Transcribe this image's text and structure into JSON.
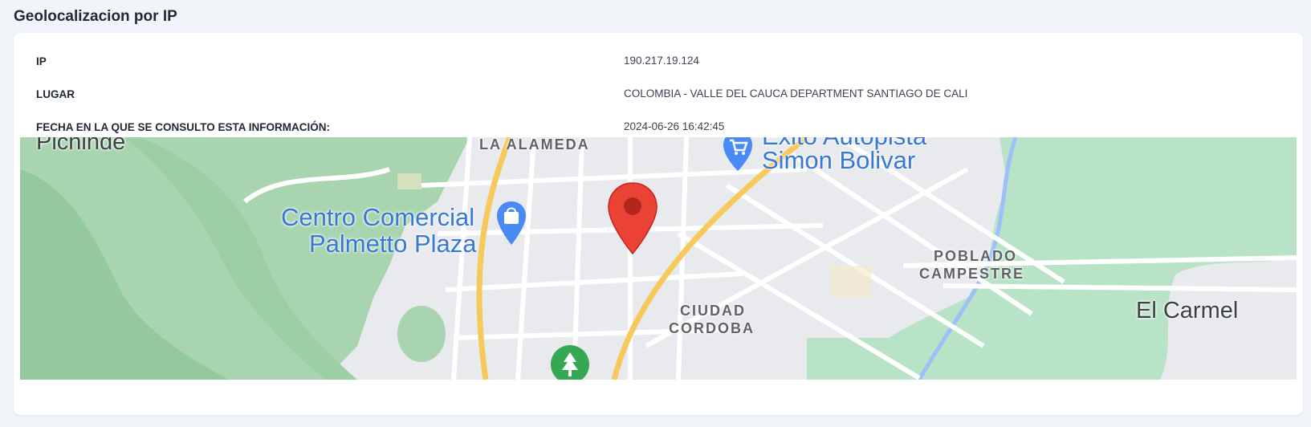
{
  "section": {
    "title": "Geolocalizacion por IP"
  },
  "info": {
    "ip_label": "IP",
    "ip_value": "190.217.19.124",
    "place_label": "LUGAR",
    "place_value": "COLOMBIA - VALLE DEL CAUCA DEPARTMENT SANTIAGO DE CALI",
    "date_label": "FECHA EN LA QUE SE CONSULTO ESTA INFORMACIÓN:",
    "date_value": "2024-06-26 16:42:45"
  },
  "map": {
    "labels": {
      "pichinde": "Pichinde",
      "alameda": "LA ALAMEDA",
      "exito_1": "Exito Autopista",
      "exito_2": "Simon Bolivar",
      "centro_1": "Centro Comercial",
      "centro_2": "Palmetto Plaza",
      "poblado_1": "POBLADO",
      "poblado_2": "CAMPESTRE",
      "ciudad_1": "CIUDAD",
      "ciudad_2": "CORDOBA",
      "carmel": "El Carmel"
    },
    "colors": {
      "park": "#b9e3c6",
      "terrain": "#a8d5b0",
      "road": "#ffffff",
      "highway": "#f6c95a",
      "marker": "#ea4335",
      "water": "#9cc0f9"
    },
    "icons": [
      "shopping-bag-icon",
      "shopping-cart-icon",
      "tree-icon",
      "location-pin-icon"
    ]
  }
}
